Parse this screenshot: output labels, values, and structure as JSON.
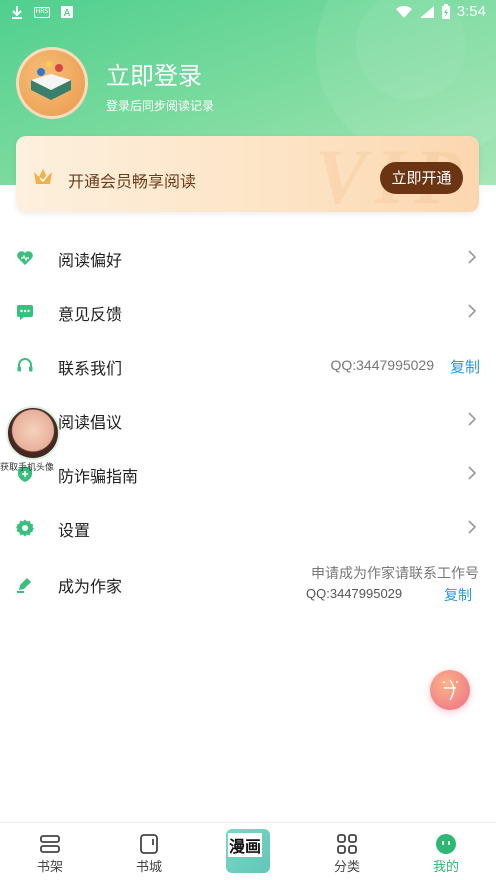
{
  "status_bar": {
    "time": "3:54",
    "box_icon_text": "HRS"
  },
  "colors": {
    "brand_green": "#4fcf8e",
    "vip_button": "#6b3514",
    "link_blue": "#2a9ad8"
  },
  "profile": {
    "title": "立即登录",
    "subtitle": "登录后同步阅读记录"
  },
  "vip": {
    "watermark": "VIP",
    "text": "开通会员畅享阅读",
    "button": "立即开通"
  },
  "menu": [
    {
      "label": "阅读偏好",
      "icon": "heart-icon"
    },
    {
      "label": "意见反馈",
      "icon": "chat-icon"
    },
    {
      "label": "联系我们",
      "icon": "headset-icon",
      "qq": "QQ:3447995029",
      "copy": "复制"
    },
    {
      "label": "阅读倡议",
      "icon": "book-icon"
    },
    {
      "label": "防诈骗指南",
      "icon": "shield-icon"
    },
    {
      "label": "设置",
      "icon": "gear-icon"
    },
    {
      "label": "成为作家",
      "icon": "pen-icon",
      "line1": "申请成为作家请联系工作号",
      "qq": "QQ:3447995029",
      "copy": "复制"
    }
  ],
  "float_widget": {
    "caption": "获取手机头像"
  },
  "tabbar": [
    {
      "label": "书架",
      "icon": "bookshelf-icon"
    },
    {
      "label": "书城",
      "icon": "bookstore-icon"
    },
    {
      "label": "漫画",
      "icon": "comic-icon"
    },
    {
      "label": "分类",
      "icon": "grid-icon"
    },
    {
      "label": "我的",
      "icon": "profile-icon",
      "active": true
    }
  ]
}
